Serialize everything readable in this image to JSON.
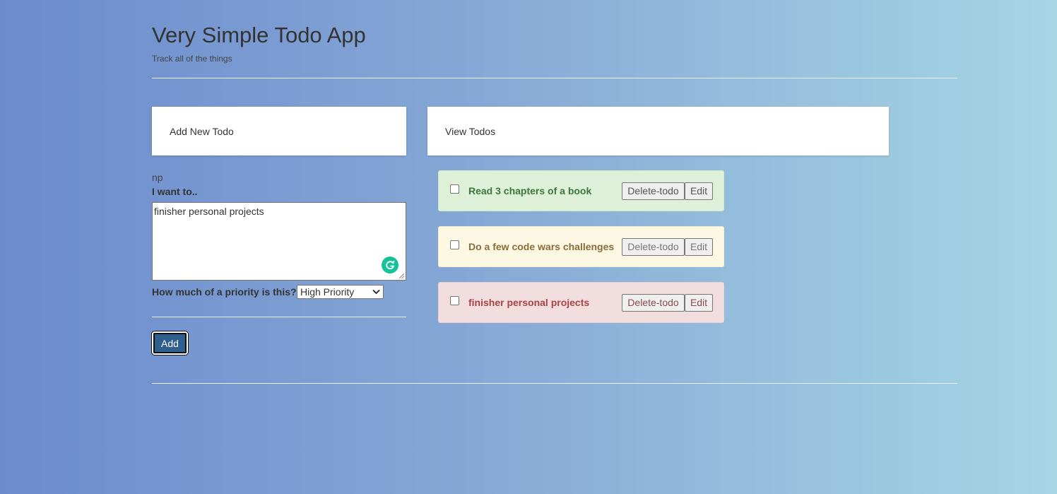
{
  "header": {
    "title": "Very Simple Todo App",
    "subtitle": "Track all of the things"
  },
  "add_panel": {
    "title": "Add New Todo",
    "user_tag": "np",
    "want_label": "I want to..",
    "textarea_value": "finisher personal projects",
    "priority_label": "How much of a priority is this?",
    "priority_selected": "High Priority",
    "add_button": "Add",
    "grammarly_color": "#15c39a"
  },
  "view_panel": {
    "title": "View Todos"
  },
  "todos": [
    {
      "text": "Read 3 chapters of a book",
      "priority": "low",
      "checked": false,
      "delete_label": "Delete-todo",
      "edit_label": "Edit",
      "color": "#dff0d8"
    },
    {
      "text": "Do a few code wars challenges",
      "priority": "medium",
      "checked": false,
      "delete_label": "Delete-todo",
      "edit_label": "Edit",
      "color": "#fcf8e3"
    },
    {
      "text": "finisher personal projects",
      "priority": "high",
      "checked": false,
      "delete_label": "Delete-todo",
      "edit_label": "Edit",
      "color": "#f2dede"
    }
  ]
}
